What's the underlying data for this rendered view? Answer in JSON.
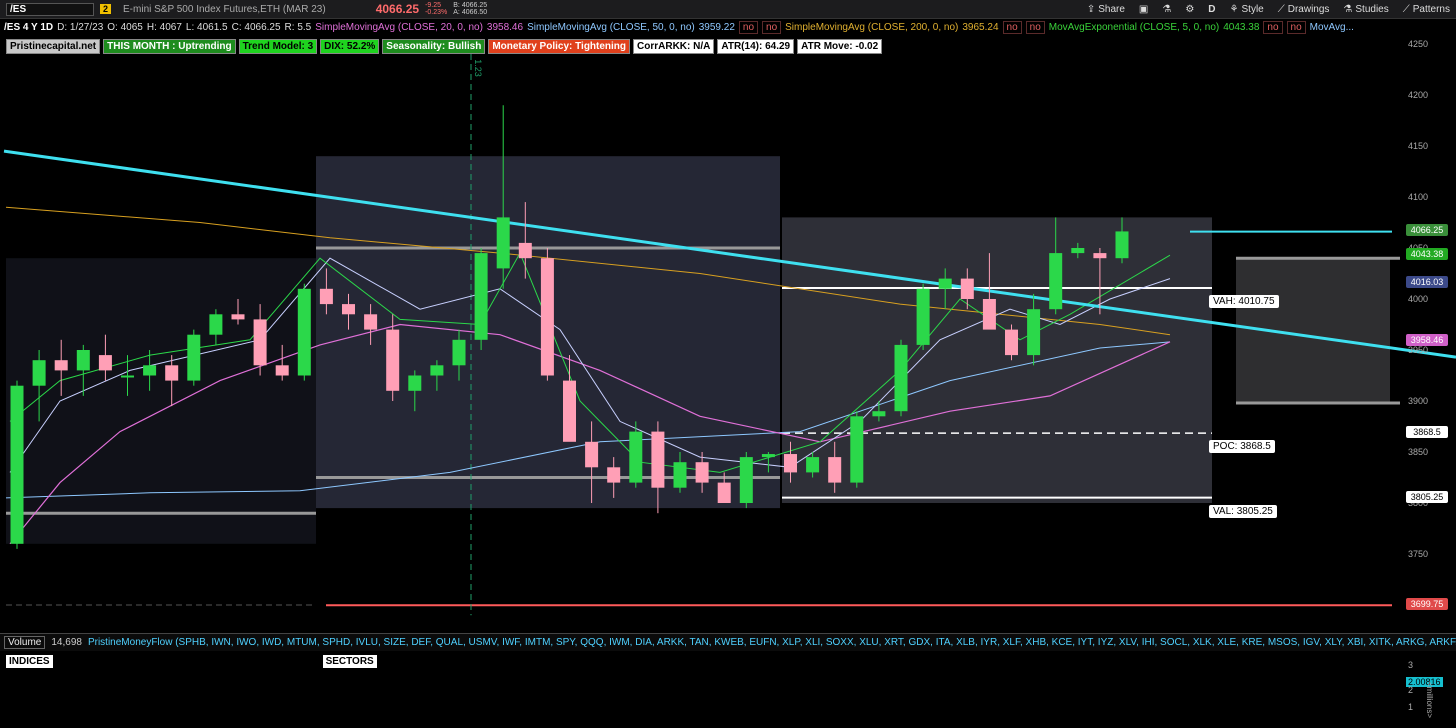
{
  "toolbar": {
    "symbol": "/ES",
    "badge": "2",
    "description": "E-mini S&P 500 Index Futures,ETH (MAR 23)",
    "last": "4066.25",
    "change": "-9.25",
    "change_pct": "-0.23%",
    "bid": "B: 4066.25",
    "ask": "A: 4066.50",
    "share": "Share",
    "aggregation": "D",
    "style": "Style",
    "drawings": "Drawings",
    "studies": "Studies",
    "patterns": "Patterns"
  },
  "info": {
    "timeframe": "/ES 4 Y 1D",
    "date": "D: 1/27/23",
    "open": "O: 4065",
    "high": "H: 4067",
    "low": "L: 4061.5",
    "close": "C: 4066.25",
    "range": "R: 5.5",
    "sma20": "SimpleMovingAvg (CLOSE, 20, 0, no)",
    "sma20_val": "3958.46",
    "sma50": "SimpleMovingAvg (CLOSE, 50, 0, no)",
    "sma50_val": "3959.22",
    "sma200": "SimpleMovingAvg (CLOSE, 200, 0, no)",
    "sma200_val": "3965.24",
    "ema5": "MovAvgExponential (CLOSE, 5, 0, no)",
    "ema5_val": "4043.38",
    "no": "no",
    "more": "MovAvg..."
  },
  "tags": [
    {
      "text": "Pristinecapital.net",
      "bg": "#c8c8c8",
      "fg": "#000"
    },
    {
      "text": "THIS MONTH : Uptrending",
      "bg": "#1e8c1e",
      "fg": "#fff"
    },
    {
      "text": "Trend Model: 3",
      "bg": "#1fd31f",
      "fg": "#000"
    },
    {
      "text": "DIX: 52.2%",
      "bg": "#1fd31f",
      "fg": "#000"
    },
    {
      "text": "Seasonality: Bullish",
      "bg": "#1e8c1e",
      "fg": "#fff"
    },
    {
      "text": "Monetary Policy: Tightening",
      "bg": "#e0401c",
      "fg": "#fff"
    },
    {
      "text": "CorrARKK: N/A",
      "bg": "#fff",
      "fg": "#000"
    },
    {
      "text": "ATR(14): 64.29",
      "bg": "#fff",
      "fg": "#000"
    },
    {
      "text": "ATR Move: -0.02",
      "bg": "#fff",
      "fg": "#000"
    }
  ],
  "price_axis": [
    "4250",
    "4200",
    "4150",
    "4100",
    "4050",
    "4000",
    "3950",
    "3900",
    "3850",
    "3800",
    "3750"
  ],
  "price_boxes": [
    {
      "text": "4066.25",
      "price": 4066.25,
      "bg": "#3a8f3a",
      "fg": "#fff"
    },
    {
      "text": "4043.38",
      "price": 4043.38,
      "bg": "#22aa22",
      "fg": "#fff"
    },
    {
      "text": "4016.03",
      "price": 4016.03,
      "bg": "#3c4a8a",
      "fg": "#fff"
    },
    {
      "text": "3958.46",
      "price": 3958.46,
      "bg": "#d060c8",
      "fg": "#fff"
    },
    {
      "text": "3868.5",
      "price": 3868.5,
      "bg": "#fff",
      "fg": "#000"
    },
    {
      "text": "3805.25",
      "price": 3805.25,
      "bg": "#fff",
      "fg": "#000"
    },
    {
      "text": "3699.75",
      "price": 3699.75,
      "bg": "#e04a4a",
      "fg": "#fff"
    }
  ],
  "levels": {
    "vah": "VAH: 4010.75",
    "poc": "POC: 3868.5",
    "val": "VAL: 3805.25",
    "vah_price": 4010.75,
    "poc_price": 3868.5,
    "val_price": 3805.25,
    "support_price": 3699.75
  },
  "vertical_marker": "1.23",
  "chart_data": {
    "type": "candlestick",
    "ylim": [
      3700,
      4265
    ],
    "candles": [
      [
        3760,
        3920,
        3755,
        3915
      ],
      [
        3915,
        3950,
        3880,
        3940
      ],
      [
        3940,
        3960,
        3905,
        3930
      ],
      [
        3930,
        3955,
        3905,
        3950
      ],
      [
        3945,
        3965,
        3920,
        3930
      ],
      [
        3925,
        3945,
        3905,
        3925
      ],
      [
        3925,
        3950,
        3910,
        3935
      ],
      [
        3935,
        3945,
        3895,
        3920
      ],
      [
        3920,
        3970,
        3915,
        3965
      ],
      [
        3965,
        3990,
        3955,
        3985
      ],
      [
        3985,
        4000,
        3975,
        3980
      ],
      [
        3980,
        3995,
        3925,
        3935
      ],
      [
        3935,
        3955,
        3920,
        3925
      ],
      [
        3925,
        4015,
        3920,
        4010
      ],
      [
        4010,
        4030,
        3985,
        3995
      ],
      [
        3995,
        4005,
        3970,
        3985
      ],
      [
        3985,
        3995,
        3955,
        3970
      ],
      [
        3970,
        3985,
        3900,
        3910
      ],
      [
        3910,
        3930,
        3890,
        3925
      ],
      [
        3925,
        3940,
        3910,
        3935
      ],
      [
        3935,
        3970,
        3920,
        3960
      ],
      [
        3960,
        4050,
        3950,
        4045
      ],
      [
        4030,
        4190,
        4010,
        4080
      ],
      [
        4055,
        4095,
        4020,
        4040
      ],
      [
        4040,
        4050,
        3920,
        3925
      ],
      [
        3920,
        3945,
        3880,
        3860
      ],
      [
        3860,
        3880,
        3800,
        3835
      ],
      [
        3835,
        3845,
        3805,
        3820
      ],
      [
        3820,
        3880,
        3815,
        3870
      ],
      [
        3870,
        3880,
        3790,
        3815
      ],
      [
        3815,
        3850,
        3810,
        3840
      ],
      [
        3840,
        3850,
        3810,
        3820
      ],
      [
        3820,
        3830,
        3805,
        3800
      ],
      [
        3800,
        3850,
        3795,
        3845
      ],
      [
        3845,
        3850,
        3830,
        3848
      ],
      [
        3848,
        3860,
        3820,
        3830
      ],
      [
        3830,
        3850,
        3825,
        3845
      ],
      [
        3845,
        3860,
        3810,
        3820
      ],
      [
        3820,
        3890,
        3815,
        3885
      ],
      [
        3885,
        3900,
        3880,
        3890
      ],
      [
        3890,
        3960,
        3885,
        3955
      ],
      [
        3955,
        4015,
        3950,
        4010
      ],
      [
        4010,
        4030,
        3990,
        4020
      ],
      [
        4020,
        4030,
        3990,
        4000
      ],
      [
        4000,
        4045,
        3975,
        3970
      ],
      [
        3970,
        3975,
        3940,
        3945
      ],
      [
        3945,
        4005,
        3935,
        3990
      ],
      [
        3990,
        4080,
        3985,
        4045
      ],
      [
        4045,
        4055,
        4040,
        4050
      ],
      [
        4045,
        4050,
        3985,
        4040
      ],
      [
        4040,
        4080,
        4035,
        4066.25
      ]
    ]
  },
  "lower": {
    "volume_label": "Volume",
    "volume_value": "14,698",
    "pmf_label": "PristineMoneyFlow (SPHB, IWN, IWO, IWD, MTUM, SPHD, IVLU, SIZE, DEF, QUAL, USMV, IWF, IMTM, SPY, QQQ, IWM, DIA, ARKK, TAN, KWEB, EUFN, XLP, XLI, SOXX, XLU, XRT, GDX, ITA, XLB, IYR, XLF, XHB, KCE, IYT, IYZ, XLV, IHI, SOCL, XLK, XLE, KRE, MSOS, IGV, XLY, XBI, XITK, ARKG, ARKF,...",
    "indices": "INDICES",
    "sectors": "SECTORS",
    "vol_scale": [
      "3",
      "2",
      "1"
    ],
    "mf_value": "2.00816",
    "axis_unit": "<millions>"
  }
}
